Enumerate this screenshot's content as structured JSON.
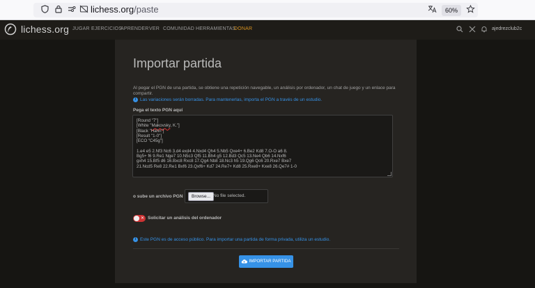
{
  "browser": {
    "url_host": "lichess.org",
    "url_path": "/paste",
    "zoom": "60%"
  },
  "header": {
    "brand": "lichess.org",
    "nav": [
      "JUGAR",
      "EJERCICIOS",
      "APRENDER",
      "VER",
      "COMUNIDAD",
      "HERRAMIENTAS",
      "DONAR"
    ],
    "user": "ajedrezclub2c",
    "accent_color": "#d59120"
  },
  "main": {
    "title": "Importar partida",
    "intro": "Al pegar el PGN de una partida, se obtiene una repetición navegable, un análisis por ordenador, un chat de juego y un enlace para compartir.",
    "variations_note": "Las variaciones serán borradas. Para mantenerlas, importa el PGN a través de un estudio.",
    "pgn_label": "Pega el texto PGN aquí",
    "pgn_lines": [
      "[Round \"7\"]",
      "[White \"",
      "Makovsky",
      ", K.\"]",
      "[Black \"Hahn\"]",
      "[Result \"1-0\"]",
      "[ECO \"C45g\"]",
      "",
      "1.e4 e5 2.Nf3 Nc6 3.d4 exd4 4.Nxd4 Qh4 5.Nb5 Qxe4+ 6.Be2 Kd8 7.O-O a6 8.",
      "Bg5+ f6 9.Re1 Nge7 10.N5c3 Qf5 11.Bh4 g5 12.Bd3 Qc5 13.Ne4 Qb6 14.Nxf6",
      "gxh4 15.Bf5 d6 16.Bxc8 Rxc8 17.Qg4 Nb8 18.Nc3 h5 19.Qg6 Qc6 20.Rxe7 Bxe7",
      "21.Ncd5 Re8 22.Re1 Bxf6 23.Qxf6+ Kd7 24.Re7+ Kd8 25.Rxe8+ Kxe8 26.Qe7# 1-0"
    ],
    "file_label": "o sube un archivo PGN",
    "browse_label": "Browse...",
    "file_status": "No file selected.",
    "analysis_label": "Solicitar un análisis del ordenador",
    "public_note": "Este PGN es de acceso público. Para importar una partida de forma privada, utiliza un estudio.",
    "submit_label": "IMPORTAR PARTIDA",
    "info_color": "#3692e7"
  }
}
